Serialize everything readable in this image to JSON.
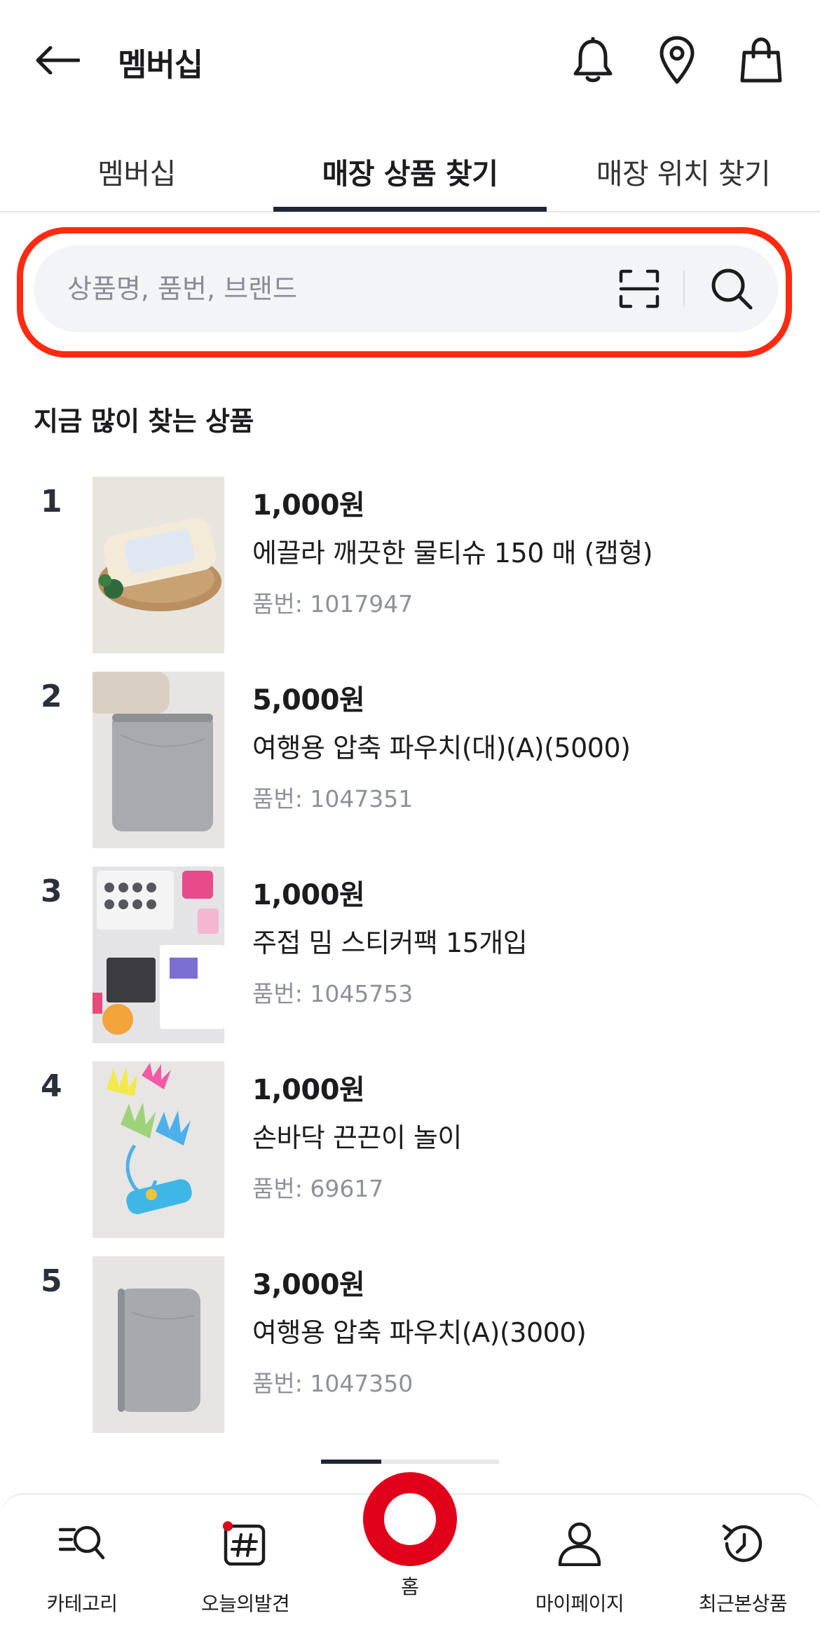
{
  "header": {
    "title": "멤버십",
    "back_icon": "arrow-left-icon",
    "icons": [
      "bell-icon",
      "location-pin-icon",
      "shopping-bag-icon"
    ]
  },
  "tabs": [
    {
      "label": "멤버십",
      "active": false
    },
    {
      "label": "매장 상품 찾기",
      "active": true
    },
    {
      "label": "매장 위치 찾기",
      "active": false
    }
  ],
  "search": {
    "placeholder": "상품명, 품번, 브랜드",
    "value": "",
    "highlight_color": "#ff2a10"
  },
  "section": {
    "title": "지금 많이 찾는 상품"
  },
  "products": [
    {
      "rank": "1",
      "price": "1,000원",
      "name": "에끌라 깨끗한 물티슈 150 매 (캡형)",
      "code": "품번: 1017947"
    },
    {
      "rank": "2",
      "price": "5,000원",
      "name": "여행용 압축 파우치(대)(A)(5000)",
      "code": "품번: 1047351"
    },
    {
      "rank": "3",
      "price": "1,000원",
      "name": "주접 밈 스티커팩 15개입",
      "code": "품번: 1045753"
    },
    {
      "rank": "4",
      "price": "1,000원",
      "name": "손바닥 끈끈이 놀이",
      "code": "품번: 69617"
    },
    {
      "rank": "5",
      "price": "3,000원",
      "name": "여행용 압축 파우치(A)(3000)",
      "code": "품번: 1047350"
    }
  ],
  "pager": {
    "current": 1,
    "total": 3
  },
  "bottom_nav": [
    {
      "label": "카테고리",
      "icon": "category-search-icon"
    },
    {
      "label": "오늘의발견",
      "icon": "hashtag-icon"
    },
    {
      "label": "홈",
      "icon": "home-ring-icon"
    },
    {
      "label": "마이페이지",
      "icon": "user-icon"
    },
    {
      "label": "최근본상품",
      "icon": "history-icon"
    }
  ],
  "colors": {
    "accent": "#e0001a",
    "tab_indicator": "#1f2536",
    "search_bg": "#f3f4f7"
  }
}
